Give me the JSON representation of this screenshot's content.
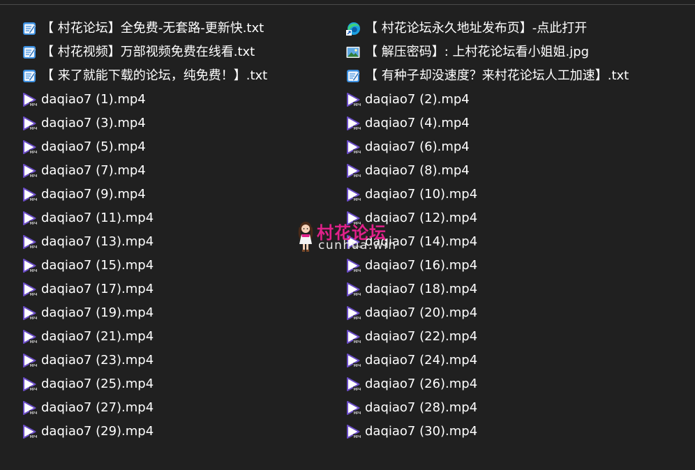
{
  "colors": {
    "background": "#202020",
    "text": "#ffffff",
    "watermark_title": "#e0218a",
    "video_icon": "#6a4cc6"
  },
  "files": [
    {
      "name": "【 村花论坛】全免费-无套路-更新快.txt",
      "icon": "notepad-icon"
    },
    {
      "name": "【 村花论坛永久地址发布页】-点此打开",
      "icon": "edge-shortcut-icon"
    },
    {
      "name": "【 村花视频】万部视频免费在线看.txt",
      "icon": "notepad-icon"
    },
    {
      "name": "【 解压密码】: 上村花论坛看小姐姐.jpg",
      "icon": "image-icon"
    },
    {
      "name": "【 来了就能下载的论坛，纯免费！】.txt",
      "icon": "notepad-icon"
    },
    {
      "name": "【 有种子却没速度？来村花论坛人工加速】.txt",
      "icon": "notepad-icon"
    },
    {
      "name": "daqiao7 (1).mp4",
      "icon": "video-file-icon"
    },
    {
      "name": "daqiao7 (2).mp4",
      "icon": "video-file-icon"
    },
    {
      "name": "daqiao7 (3).mp4",
      "icon": "video-file-icon"
    },
    {
      "name": "daqiao7 (4).mp4",
      "icon": "video-file-icon"
    },
    {
      "name": "daqiao7 (5).mp4",
      "icon": "video-file-icon"
    },
    {
      "name": "daqiao7 (6).mp4",
      "icon": "video-file-icon"
    },
    {
      "name": "daqiao7 (7).mp4",
      "icon": "video-file-icon"
    },
    {
      "name": "daqiao7 (8).mp4",
      "icon": "video-file-icon"
    },
    {
      "name": "daqiao7 (9).mp4",
      "icon": "video-file-icon"
    },
    {
      "name": "daqiao7 (10).mp4",
      "icon": "video-file-icon"
    },
    {
      "name": "daqiao7 (11).mp4",
      "icon": "video-file-icon"
    },
    {
      "name": "daqiao7 (12).mp4",
      "icon": "video-file-icon"
    },
    {
      "name": "daqiao7 (13).mp4",
      "icon": "video-file-icon"
    },
    {
      "name": "daqiao7 (14).mp4",
      "icon": "video-file-icon"
    },
    {
      "name": "daqiao7 (15).mp4",
      "icon": "video-file-icon"
    },
    {
      "name": "daqiao7 (16).mp4",
      "icon": "video-file-icon"
    },
    {
      "name": "daqiao7 (17).mp4",
      "icon": "video-file-icon"
    },
    {
      "name": "daqiao7 (18).mp4",
      "icon": "video-file-icon"
    },
    {
      "name": "daqiao7 (19).mp4",
      "icon": "video-file-icon"
    },
    {
      "name": "daqiao7 (20).mp4",
      "icon": "video-file-icon"
    },
    {
      "name": "daqiao7 (21).mp4",
      "icon": "video-file-icon"
    },
    {
      "name": "daqiao7 (22).mp4",
      "icon": "video-file-icon"
    },
    {
      "name": "daqiao7 (23).mp4",
      "icon": "video-file-icon"
    },
    {
      "name": "daqiao7 (24).mp4",
      "icon": "video-file-icon"
    },
    {
      "name": "daqiao7 (25).mp4",
      "icon": "video-file-icon"
    },
    {
      "name": "daqiao7 (26).mp4",
      "icon": "video-file-icon"
    },
    {
      "name": "daqiao7 (27).mp4",
      "icon": "video-file-icon"
    },
    {
      "name": "daqiao7 (28).mp4",
      "icon": "video-file-icon"
    },
    {
      "name": "daqiao7 (29).mp4",
      "icon": "video-file-icon"
    },
    {
      "name": "daqiao7 (30).mp4",
      "icon": "video-file-icon"
    }
  ],
  "watermark": {
    "title": "村花论坛",
    "domain": "cunhua.win",
    "icon": "cartoon-girl-icon"
  }
}
